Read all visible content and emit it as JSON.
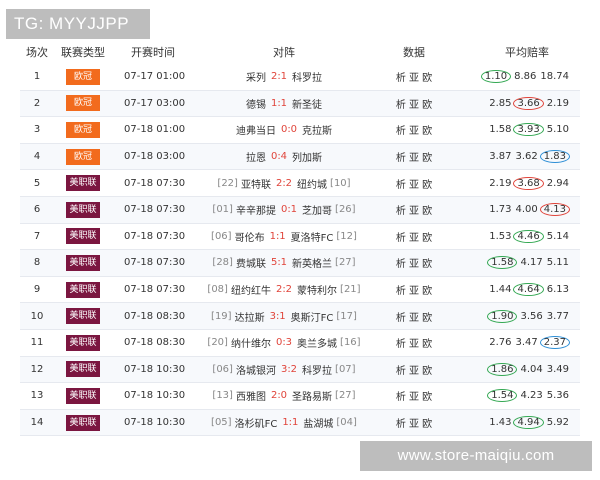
{
  "tg_label": "TG: MYYJJPP",
  "watermark": "www.store-maiqiu.com",
  "headers": {
    "index": "场次",
    "league": "联赛类型",
    "time": "开赛时间",
    "match": "对阵",
    "data": "数据",
    "odds": "平均赔率"
  },
  "colors": {
    "orange_league": "#f26b1d",
    "maroon_league": "#7b1640",
    "score": "#e0443a",
    "ring_green": "#34a853",
    "ring_red": "#e0443a",
    "ring_blue": "#2e8fd6"
  },
  "rows": [
    {
      "index": "1",
      "league": "欧冠",
      "league_color": "orange",
      "time": "07-17 01:00",
      "home_rank": "",
      "home": "采列",
      "score": "2:1",
      "away": "科罗拉",
      "away_rank": "",
      "data": "析 亚 欧",
      "odds": [
        "1.10",
        "8.86",
        "18.74"
      ],
      "ring_idx": 0,
      "ring": "green"
    },
    {
      "index": "2",
      "league": "欧冠",
      "league_color": "orange",
      "time": "07-17 03:00",
      "home_rank": "",
      "home": "德锡",
      "score": "1:1",
      "away": "新圣徒",
      "away_rank": "",
      "data": "析 亚 欧",
      "odds": [
        "2.85",
        "3.66",
        "2.19"
      ],
      "ring_idx": 1,
      "ring": "red"
    },
    {
      "index": "3",
      "league": "欧冠",
      "league_color": "orange",
      "time": "07-18 01:00",
      "home_rank": "",
      "home": "迪弗当日",
      "score": "0:0",
      "away": "克拉斯",
      "away_rank": "",
      "data": "析 亚 欧",
      "odds": [
        "1.58",
        "3.93",
        "5.10"
      ],
      "ring_idx": 1,
      "ring": "green"
    },
    {
      "index": "4",
      "league": "欧冠",
      "league_color": "orange",
      "time": "07-18 03:00",
      "home_rank": "",
      "home": "拉恩",
      "score": "0:4",
      "away": "列加斯",
      "away_rank": "",
      "data": "析 亚 欧",
      "odds": [
        "3.87",
        "3.62",
        "1.83"
      ],
      "ring_idx": 2,
      "ring": "blue"
    },
    {
      "index": "5",
      "league": "美职联",
      "league_color": "maroon",
      "time": "07-18 07:30",
      "home_rank": "[22]",
      "home": "亚特联",
      "score": "2:2",
      "away": "纽约城",
      "away_rank": "[10]",
      "data": "析 亚 欧",
      "odds": [
        "2.19",
        "3.68",
        "2.94"
      ],
      "ring_idx": 1,
      "ring": "red"
    },
    {
      "index": "6",
      "league": "美职联",
      "league_color": "maroon",
      "time": "07-18 07:30",
      "home_rank": "[01]",
      "home": "辛辛那提",
      "score": "0:1",
      "away": "芝加哥",
      "away_rank": "[26]",
      "data": "析 亚 欧",
      "odds": [
        "1.73",
        "4.00",
        "4.13"
      ],
      "ring_idx": 2,
      "ring": "red"
    },
    {
      "index": "7",
      "league": "美职联",
      "league_color": "maroon",
      "time": "07-18 07:30",
      "home_rank": "[06]",
      "home": "哥伦布",
      "score": "1:1",
      "away": "夏洛特FC",
      "away_rank": "[12]",
      "data": "析 亚 欧",
      "odds": [
        "1.53",
        "4.46",
        "5.14"
      ],
      "ring_idx": 1,
      "ring": "green"
    },
    {
      "index": "8",
      "league": "美职联",
      "league_color": "maroon",
      "time": "07-18 07:30",
      "home_rank": "[28]",
      "home": "费城联",
      "score": "5:1",
      "away": "新英格兰",
      "away_rank": "[27]",
      "data": "析 亚 欧",
      "odds": [
        "1.58",
        "4.17",
        "5.11"
      ],
      "ring_idx": 0,
      "ring": "green"
    },
    {
      "index": "9",
      "league": "美职联",
      "league_color": "maroon",
      "time": "07-18 07:30",
      "home_rank": "[08]",
      "home": "纽约红牛",
      "score": "2:2",
      "away": "蒙特利尔",
      "away_rank": "[21]",
      "data": "析 亚 欧",
      "odds": [
        "1.44",
        "4.64",
        "6.13"
      ],
      "ring_idx": 1,
      "ring": "green"
    },
    {
      "index": "10",
      "league": "美职联",
      "league_color": "maroon",
      "time": "07-18 08:30",
      "home_rank": "[19]",
      "home": "达拉斯",
      "score": "3:1",
      "away": "奥斯汀FC",
      "away_rank": "[17]",
      "data": "析 亚 欧",
      "odds": [
        "1.90",
        "3.56",
        "3.77"
      ],
      "ring_idx": 0,
      "ring": "green"
    },
    {
      "index": "11",
      "league": "美职联",
      "league_color": "maroon",
      "time": "07-18 08:30",
      "home_rank": "[20]",
      "home": "纳什维尔",
      "score": "0:3",
      "away": "奥兰多城",
      "away_rank": "[16]",
      "data": "析 亚 欧",
      "odds": [
        "2.76",
        "3.47",
        "2.37"
      ],
      "ring_idx": 2,
      "ring": "blue"
    },
    {
      "index": "12",
      "league": "美职联",
      "league_color": "maroon",
      "time": "07-18 10:30",
      "home_rank": "[06]",
      "home": "洛城银河",
      "score": "3:2",
      "away": "科罗拉",
      "away_rank": "[07]",
      "data": "析 亚 欧",
      "odds": [
        "1.86",
        "4.04",
        "3.49"
      ],
      "ring_idx": 0,
      "ring": "green"
    },
    {
      "index": "13",
      "league": "美职联",
      "league_color": "maroon",
      "time": "07-18 10:30",
      "home_rank": "[13]",
      "home": "西雅图",
      "score": "2:0",
      "away": "圣路易斯",
      "away_rank": "[27]",
      "data": "析 亚 欧",
      "odds": [
        "1.54",
        "4.23",
        "5.36"
      ],
      "ring_idx": 0,
      "ring": "green"
    },
    {
      "index": "14",
      "league": "美职联",
      "league_color": "maroon",
      "time": "07-18 10:30",
      "home_rank": "[05]",
      "home": "洛杉矶FC",
      "score": "1:1",
      "away": "盐湖城",
      "away_rank": "[04]",
      "data": "析 亚 欧",
      "odds": [
        "1.43",
        "4.94",
        "5.92"
      ],
      "ring_idx": 1,
      "ring": "green"
    }
  ]
}
